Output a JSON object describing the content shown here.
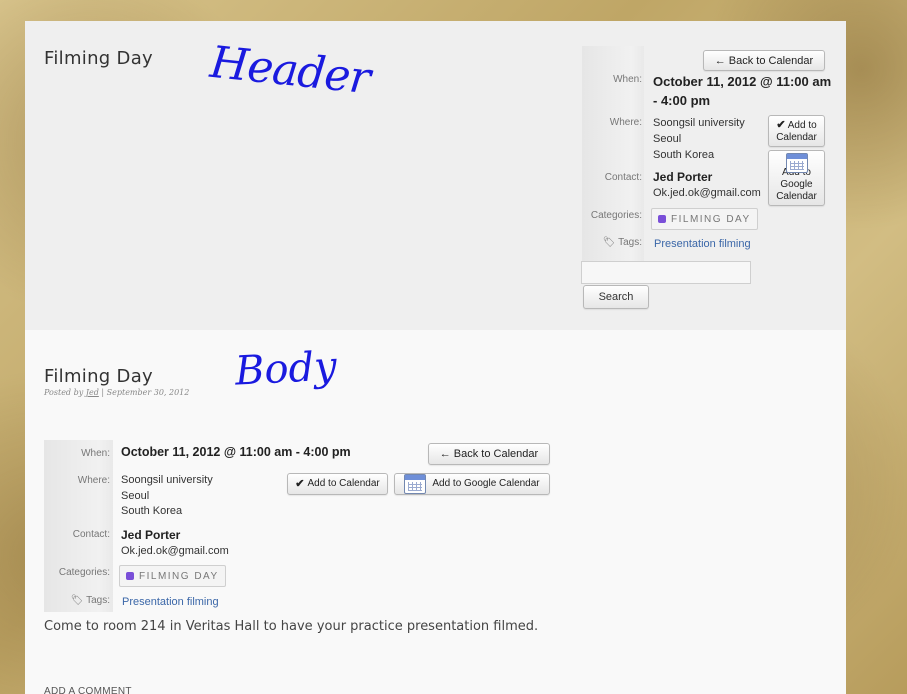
{
  "header": {
    "title": "Filming Day",
    "annotation": "Header",
    "back_button": "Back to Calendar",
    "labels": {
      "when": "When:",
      "where": "Where:",
      "contact": "Contact:",
      "categories": "Categories:",
      "tags": "Tags:"
    },
    "when_value": "October 11, 2012 @ 11:00 am - 4:00 pm",
    "where_lines": [
      "Soongsil university",
      "Seoul",
      "South Korea"
    ],
    "contact_name": "Jed Porter",
    "contact_email": "Ok.jed.ok@gmail.com",
    "category": "FILMING DAY",
    "tags_value": "Presentation filming",
    "add_to_calendar": "Add to Calendar",
    "add_to_google": "Add to Google Calendar",
    "search_button": "Search",
    "search_value": ""
  },
  "body": {
    "title": "Filming Day",
    "annotation": "Body",
    "posted_by_label": "Posted by",
    "author": "Jed",
    "date": "September 30, 2012",
    "back_button": "Back to Calendar",
    "labels": {
      "when": "When:",
      "where": "Where:",
      "contact": "Contact:",
      "categories": "Categories:",
      "tags": "Tags:"
    },
    "when_value": "October 11, 2012 @ 11:00 am - 4:00 pm",
    "where_lines": [
      "Soongsil university",
      "Seoul",
      "South Korea"
    ],
    "contact_name": "Jed Porter",
    "contact_email": "Ok.jed.ok@gmail.com",
    "category": "FILMING DAY",
    "tags_value": "Presentation filming",
    "add_to_calendar": "Add to Calendar",
    "add_to_google": "Add to Google Calendar",
    "description": "Come to room 214 in Veritas Hall to have your practice presentation filmed.",
    "comment_heading": "ADD A COMMENT"
  },
  "colors": {
    "accent_link": "#3b67a8",
    "annotation_ink": "#1a1adf",
    "category_dot": "#7a4fd8"
  },
  "icons": {
    "back": "arrow-left-icon",
    "check": "checkmark-icon",
    "calendar": "calendar-icon",
    "tag": "tag-icon"
  }
}
